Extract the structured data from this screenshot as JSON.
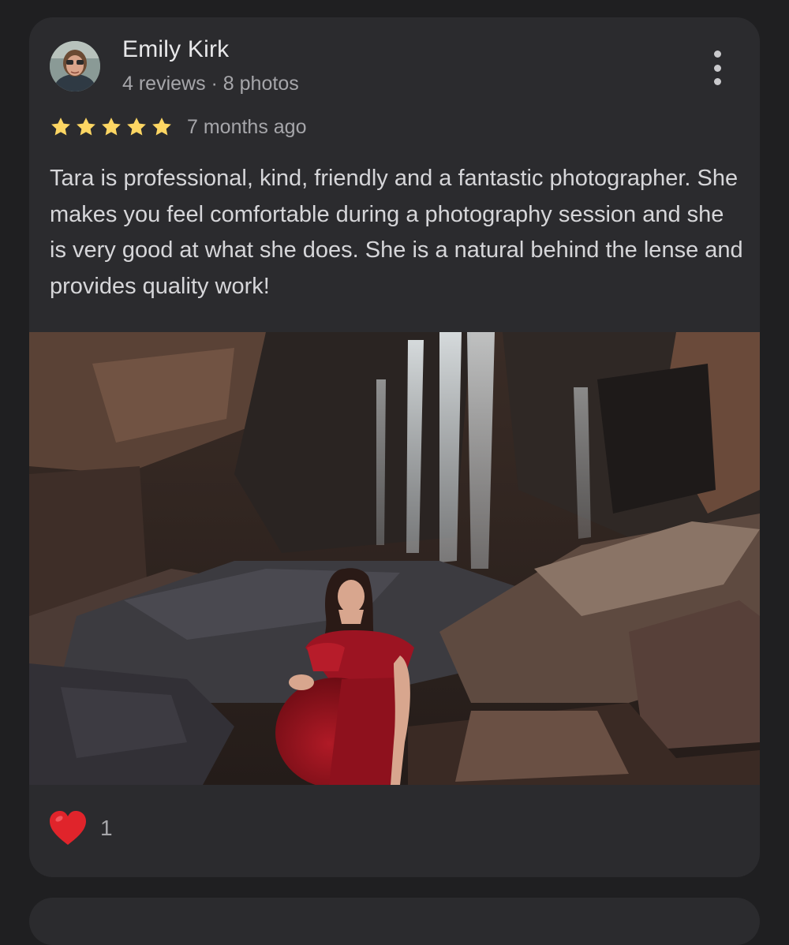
{
  "review": {
    "author_name": "Emily Kirk",
    "author_meta": "4 reviews · 8 photos",
    "rating": 5,
    "rating_max": 5,
    "time_ago": "7 months ago",
    "text": "Tara is professional, kind, friendly and a fantastic photographer. She makes you feel comfortable during a photography session and she is very good at what she does. She is a natural behind the lense and provides quality work!",
    "reaction_icon": "heart-icon",
    "reaction_count": "1"
  },
  "colors": {
    "background": "#1f1f21",
    "card": "#2b2b2e",
    "star": "#fdd663",
    "heart": "#e0242b",
    "primary_text": "#e8e8ea",
    "secondary_text": "#a6a6aa"
  }
}
